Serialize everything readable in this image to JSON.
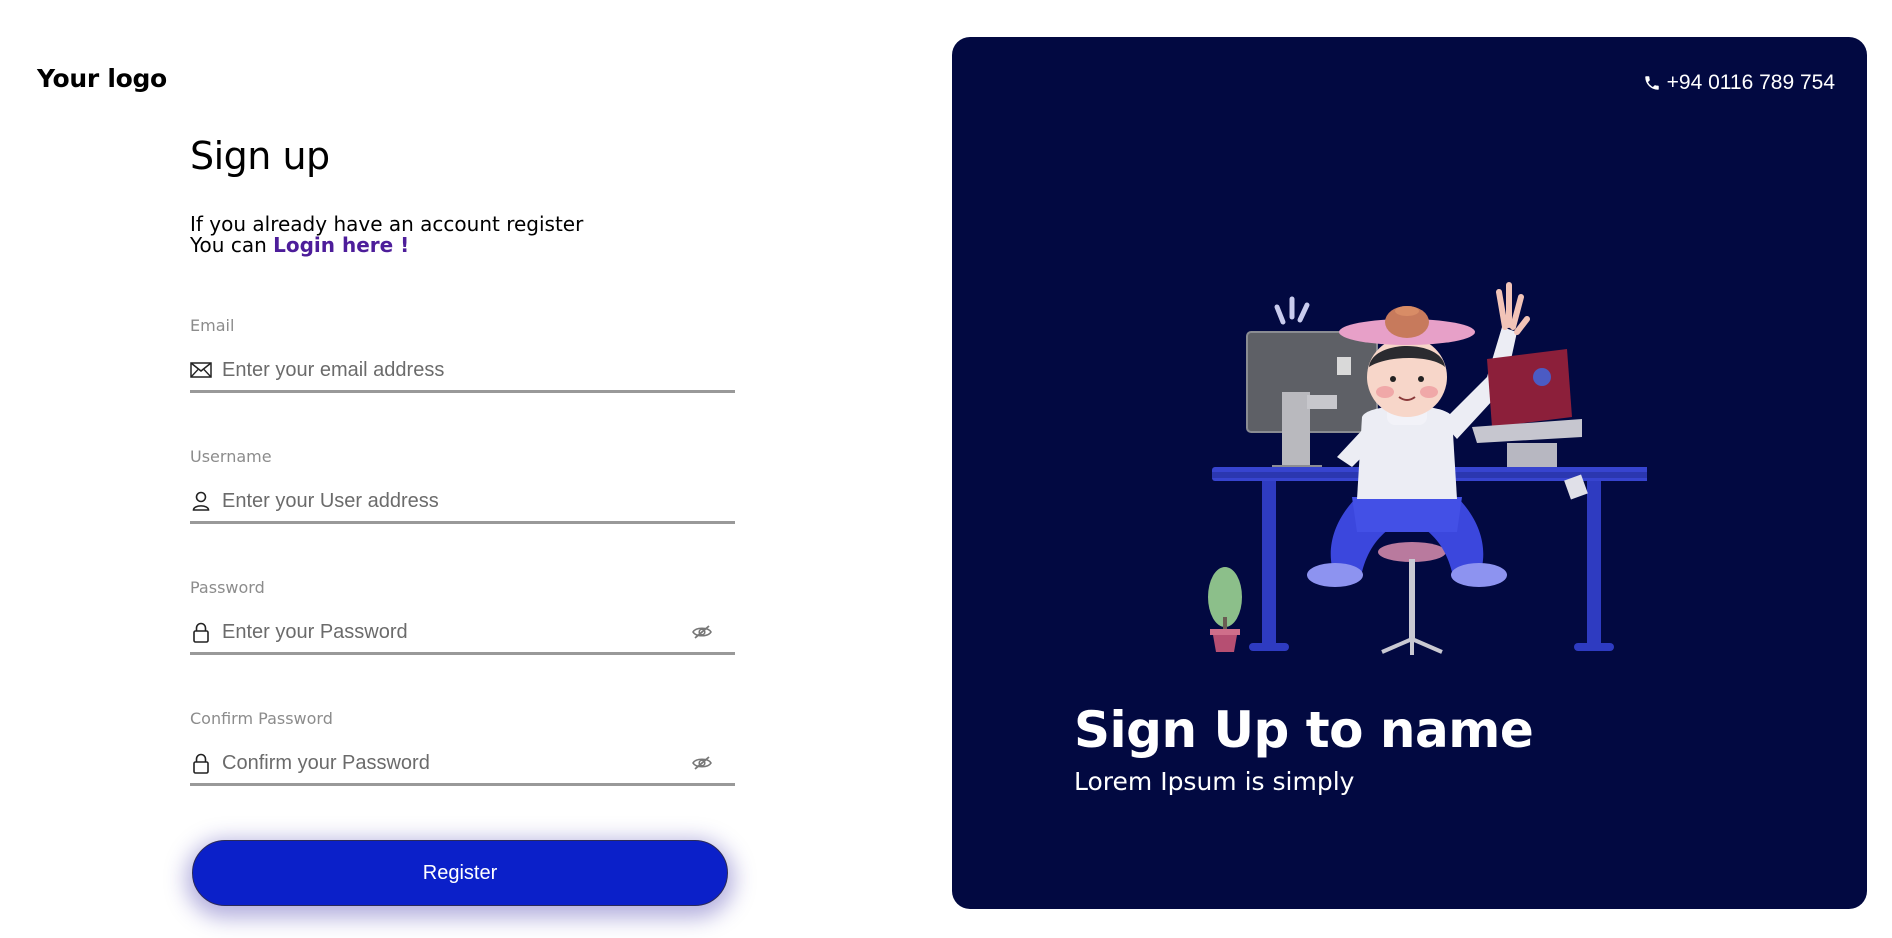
{
  "brand": {
    "logo_text": "Your logo"
  },
  "form": {
    "title": "Sign up",
    "subtitle_line1": "If you already have an account register",
    "subtitle_line2_prefix": "You can",
    "login_link": "Login here !",
    "fields": [
      {
        "label": "Email",
        "placeholder": "Enter your email address",
        "icon": "mail-icon"
      },
      {
        "label": "Username",
        "placeholder": "Enter your User address",
        "icon": "user-icon"
      },
      {
        "label": "Password",
        "placeholder": "Enter your Password",
        "icon": "lock-icon",
        "toggle_icon": "eye-off-icon"
      },
      {
        "label": "Confirm Password",
        "placeholder": "Confirm your Password",
        "icon": "lock-icon",
        "toggle_icon": "eye-off-icon"
      }
    ],
    "submit_label": "Register"
  },
  "panel": {
    "phone": "+94 0116 789 754",
    "phone_icon": "phone-icon",
    "illustration": "person-at-desk-illustration",
    "headline": "Sign Up to name",
    "tagline": "Lorem Ipsum is simply"
  },
  "colors": {
    "accent": "#0b20c9",
    "panel_bg": "#020941",
    "link": "#4d1d9a",
    "field_border": "#999999"
  }
}
